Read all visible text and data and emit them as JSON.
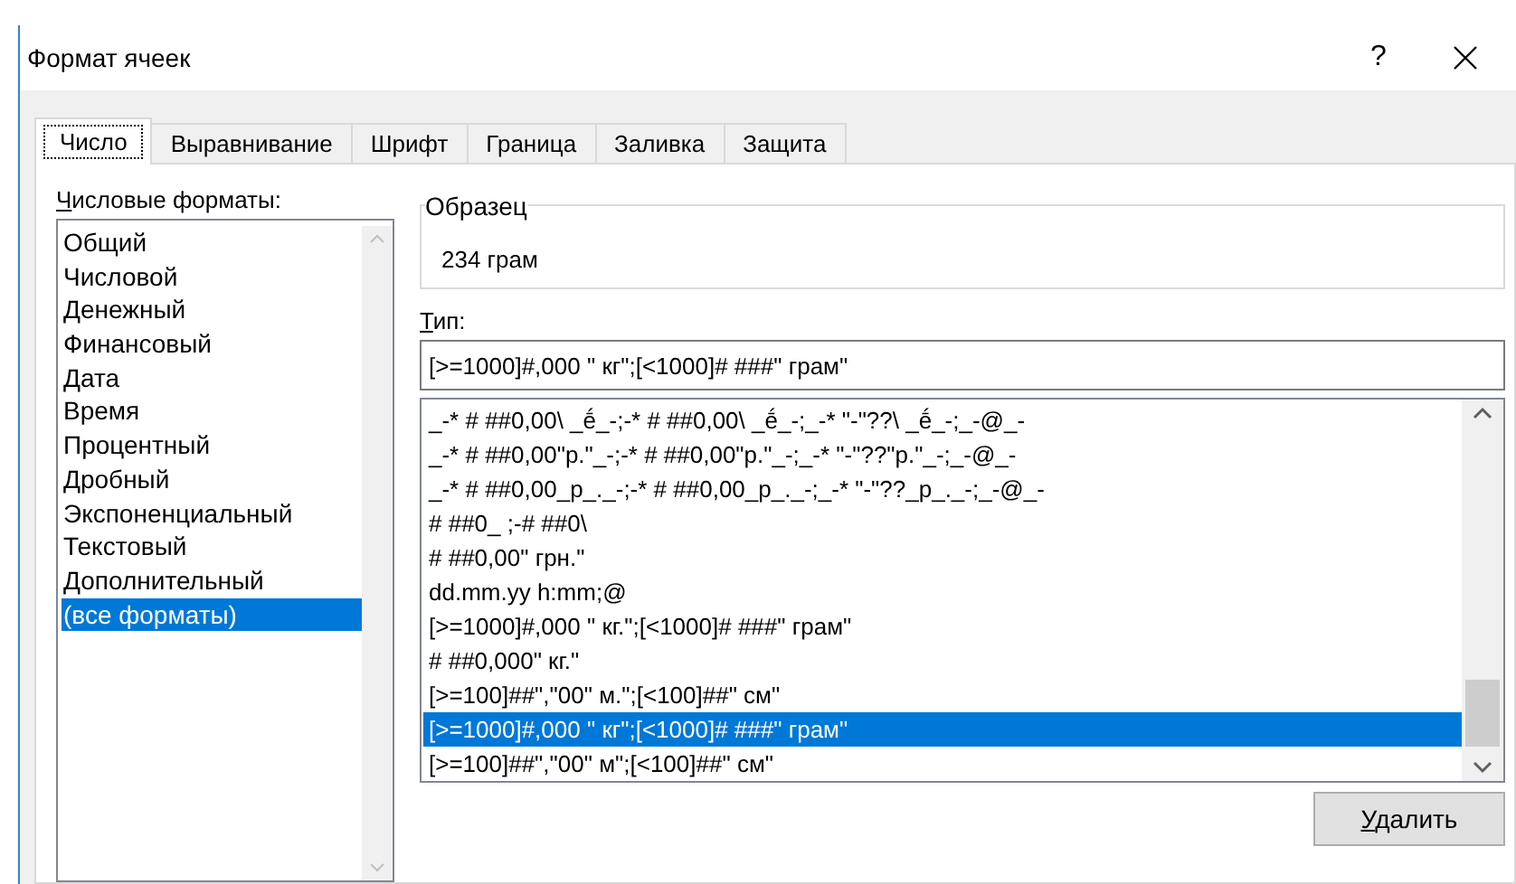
{
  "window": {
    "title": "Формат ячеек",
    "help": "?"
  },
  "tabs": [
    {
      "label": "Число",
      "selected": true
    },
    {
      "label": "Выравнивание",
      "selected": false
    },
    {
      "label": "Шрифт",
      "selected": false
    },
    {
      "label": "Граница",
      "selected": false
    },
    {
      "label": "Заливка",
      "selected": false
    },
    {
      "label": "Защита",
      "selected": false
    }
  ],
  "categories": {
    "label": "Числовые форматы:",
    "items": [
      {
        "label": "Общий",
        "selected": false
      },
      {
        "label": "Числовой",
        "selected": false
      },
      {
        "label": "Денежный",
        "selected": false
      },
      {
        "label": "Финансовый",
        "selected": false
      },
      {
        "label": "Дата",
        "selected": false
      },
      {
        "label": "Время",
        "selected": false
      },
      {
        "label": "Процентный",
        "selected": false
      },
      {
        "label": "Дробный",
        "selected": false
      },
      {
        "label": "Экспоненциальный",
        "selected": false
      },
      {
        "label": "Текстовый",
        "selected": false
      },
      {
        "label": "Дополнительный",
        "selected": false
      },
      {
        "label": "(все форматы)",
        "selected": true
      }
    ]
  },
  "sample": {
    "label": "Образец",
    "value": "234 грам"
  },
  "type": {
    "label": "Тип:",
    "value": "[>=1000]#,000 \" кг\";[<1000]# ###\" грам\""
  },
  "formats": [
    {
      "label": "_-* # ##0,00\\ _ḗ_-;-* # ##0,00\\ _ḗ_-;_-* \"-\"??\\ _ḗ_-;_-@_-",
      "selected": false
    },
    {
      "label": "_-* # ##0,00\"р.\"_-;-* # ##0,00\"р.\"_-;_-* \"-\"??\"р.\"_-;_-@_-",
      "selected": false
    },
    {
      "label": "_-* # ##0,00_р_._-;-* # ##0,00_р_._-;_-* \"-\"??_р_._-;_-@_-",
      "selected": false
    },
    {
      "label": "# ##0_ ;-# ##0\\",
      "selected": false
    },
    {
      "label": "# ##0,00\" грн.\"",
      "selected": false
    },
    {
      "label": "dd.mm.yy h:mm;@",
      "selected": false
    },
    {
      "label": "[>=1000]#,000 \" кг.\";[<1000]# ###\" грам\"",
      "selected": false
    },
    {
      "label": "# ##0,000\" кг.\"",
      "selected": false
    },
    {
      "label": "[>=100]##\",\"00\" м.\";[<100]##\" см\"",
      "selected": false
    },
    {
      "label": "[>=1000]#,000 \" кг\";[<1000]# ###\" грам\"",
      "selected": true
    },
    {
      "label": "[>=100]##\",\"00\" м\";[<100]##\" см\"",
      "selected": false
    }
  ],
  "delete_button": "Удалить"
}
